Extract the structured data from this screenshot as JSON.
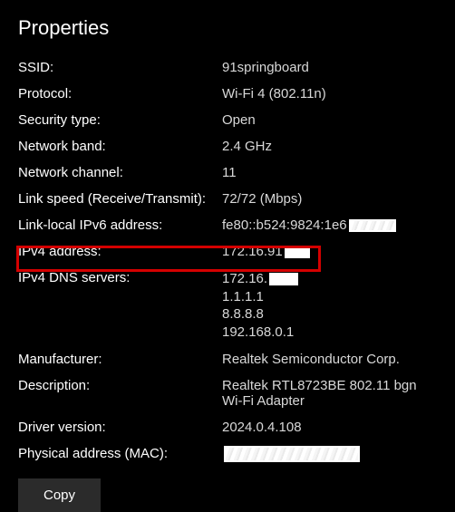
{
  "title": "Properties",
  "rows": {
    "ssid": {
      "label": "SSID:",
      "value": "91springboard"
    },
    "protocol": {
      "label": "Protocol:",
      "value": "Wi-Fi 4 (802.11n)"
    },
    "security": {
      "label": "Security type:",
      "value": "Open"
    },
    "band": {
      "label": "Network band:",
      "value": "2.4 GHz"
    },
    "channel": {
      "label": "Network channel:",
      "value": "11"
    },
    "linkspeed": {
      "label": "Link speed (Receive/Transmit):",
      "value": "72/72 (Mbps)"
    },
    "ipv6": {
      "label": "Link-local IPv6 address:",
      "value": "fe80::b524:9824:1e6"
    },
    "ipv4": {
      "label": "IPv4 address:",
      "value": "172.16.91"
    },
    "dns": {
      "label": "IPv4 DNS servers:",
      "values": [
        "172.16.",
        "1.1.1.1",
        "8.8.8.8",
        "192.168.0.1"
      ]
    },
    "manufacturer": {
      "label": "Manufacturer:",
      "value": "Realtek Semiconductor Corp."
    },
    "description": {
      "label": "Description:",
      "value": "Realtek RTL8723BE 802.11 bgn Wi-Fi Adapter"
    },
    "driver": {
      "label": "Driver version:",
      "value": "2024.0.4.108"
    },
    "mac": {
      "label": "Physical address (MAC):",
      "value": ""
    }
  },
  "copy_label": "Copy"
}
